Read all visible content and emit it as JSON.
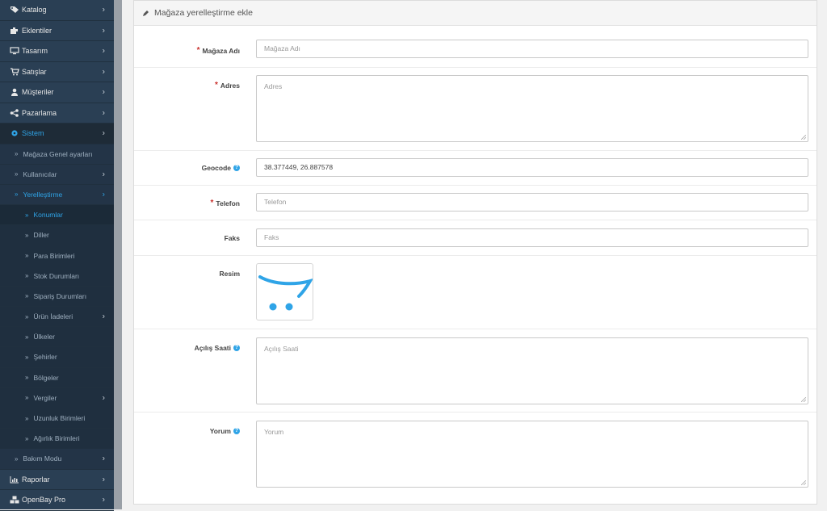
{
  "sidebar": {
    "top_items": [
      {
        "label": "Katalog",
        "icon": "tags-icon"
      },
      {
        "label": "Eklentiler",
        "icon": "puzzle-icon"
      },
      {
        "label": "Tasarım",
        "icon": "monitor-icon"
      },
      {
        "label": "Satışlar",
        "icon": "cart-icon"
      },
      {
        "label": "Müşteriler",
        "icon": "user-icon"
      },
      {
        "label": "Pazarlama",
        "icon": "share-icon"
      },
      {
        "label": "Sistem",
        "icon": "gear-icon"
      }
    ],
    "sistem_items": [
      {
        "label": "Mağaza Genel ayarları"
      },
      {
        "label": "Kullanıcılar"
      },
      {
        "label": "Yerelleştirme"
      }
    ],
    "yerel_items": [
      {
        "label": "Konumlar"
      },
      {
        "label": "Diller"
      },
      {
        "label": "Para Birimleri"
      },
      {
        "label": "Stok Durumları"
      },
      {
        "label": "Sipariş Durumları"
      },
      {
        "label": "Ürün İadeleri"
      },
      {
        "label": "Ülkeler"
      },
      {
        "label": "Şehirler"
      },
      {
        "label": "Bölgeler"
      },
      {
        "label": "Vergiler"
      },
      {
        "label": "Uzunluk Birimleri"
      },
      {
        "label": "Ağırlık Birimleri"
      }
    ],
    "bakim": {
      "label": "Bakım Modu"
    },
    "bottom_items": [
      {
        "label": "Raporlar",
        "icon": "bar-chart-icon"
      },
      {
        "label": "OpenBay Pro",
        "icon": "cubes-icon"
      }
    ],
    "chevron": "›",
    "double_chevron": "»"
  },
  "panel": {
    "title": "Mağaza yerelleştirme ekle",
    "required_mark": "*",
    "help_mark": "?",
    "fields": {
      "name": {
        "label": "Mağaza Adı",
        "placeholder": "Mağaza Adı"
      },
      "address": {
        "label": "Adres",
        "placeholder": "Adres"
      },
      "geocode": {
        "label": "Geocode",
        "value": "38.377449, 26.887578"
      },
      "phone": {
        "label": "Telefon",
        "placeholder": "Telefon"
      },
      "fax": {
        "label": "Faks",
        "placeholder": "Faks"
      },
      "image": {
        "label": "Resim"
      },
      "open": {
        "label": "Açılış Saati",
        "placeholder": "Açılış Saati"
      },
      "comment": {
        "label": "Yorum",
        "placeholder": "Yorum"
      }
    }
  },
  "colors": {
    "sidebar": "#2a3f54",
    "accent": "#2fa4e7",
    "required": "#c9302c"
  }
}
